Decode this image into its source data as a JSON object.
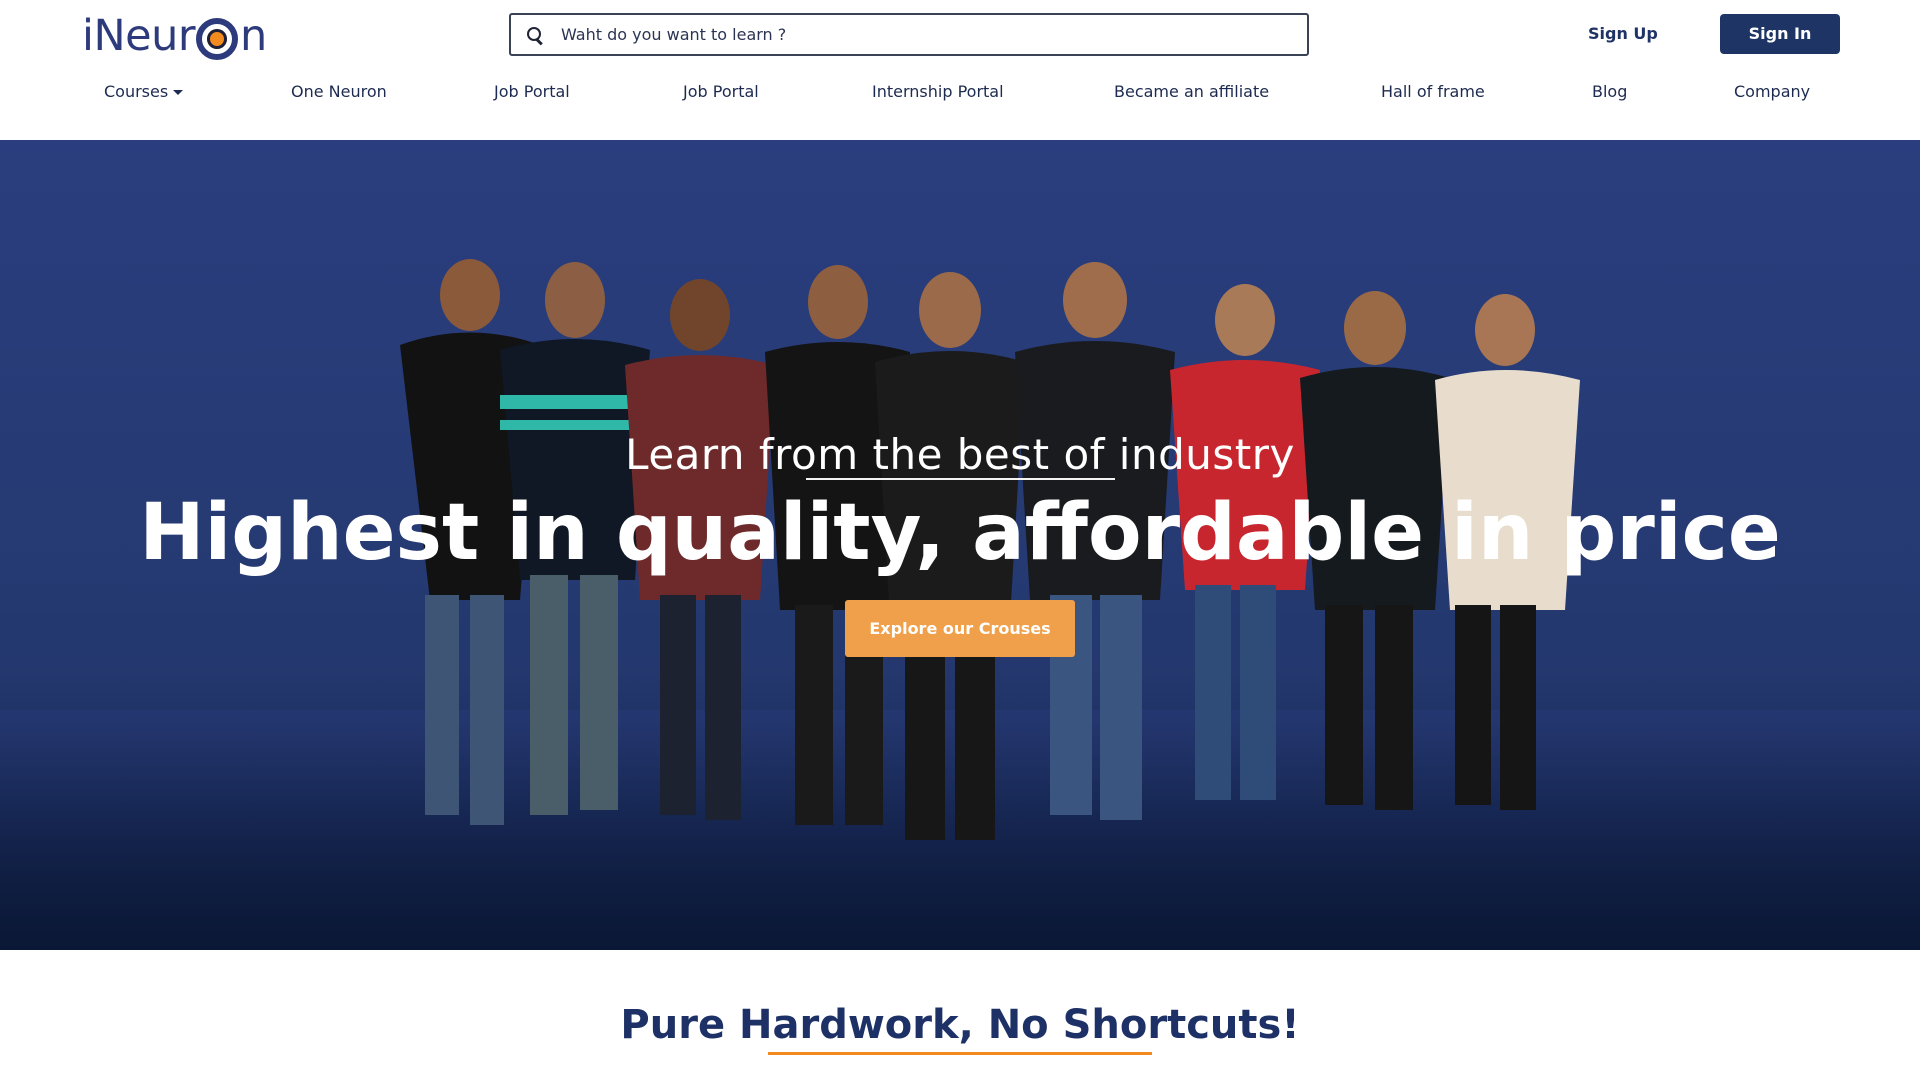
{
  "header": {
    "logo_text_prefix": "iNeur",
    "logo_text_suffix": "n",
    "search_placeholder": "Waht do you want to learn ?",
    "signup_label": "Sign Up",
    "signin_label": "Sign In"
  },
  "nav": {
    "items": [
      {
        "label": "Courses",
        "has_dropdown": true
      },
      {
        "label": "One Neuron"
      },
      {
        "label": "Job Portal"
      },
      {
        "label": "Job Portal"
      },
      {
        "label": "Internship Portal"
      },
      {
        "label": "Became an affiliate"
      },
      {
        "label": "Hall of frame"
      },
      {
        "label": "Blog"
      },
      {
        "label": "Company"
      }
    ]
  },
  "hero": {
    "eyebrow": "Learn from the best of industry",
    "headline": "Highest in quality, affordable in price",
    "cta_label": "Explore our Crouses"
  },
  "section": {
    "title": "Pure Hardwork, No Shortcuts!"
  },
  "colors": {
    "brand_navy": "#1d3464",
    "accent_orange": "#f0a04a",
    "hero_blue": "#2a3e7f"
  },
  "icons": {
    "search": "magnifier-icon",
    "dropdown": "caret-down-icon"
  }
}
